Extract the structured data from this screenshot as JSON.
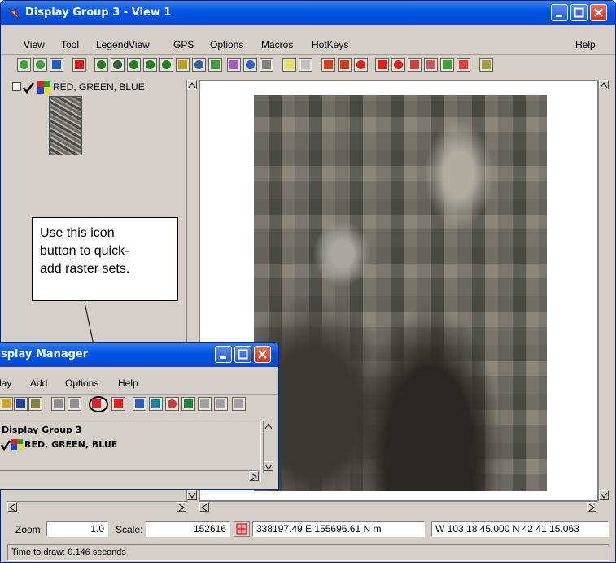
{
  "main_window": {
    "title": "Display Group 3 - View 1",
    "menu": [
      "View",
      "Tool",
      "LegendView",
      "GPS",
      "Options",
      "Macros",
      "HotKeys"
    ],
    "menu_right": "Help",
    "layer": {
      "label": "RED, GREEN, BLUE"
    },
    "status": {
      "zoom_label": "Zoom:",
      "zoom_value": "1.0",
      "scale_label": "Scale:",
      "scale_value": "152616",
      "coords_en": "338197.49 E  155696.61 N m",
      "coords_latlon": "W 103 18 45.000  N 42 41 15.063",
      "time_to_draw": "Time to draw: 0.146 seconds"
    }
  },
  "display_manager": {
    "title": "splay Manager",
    "menu": [
      "lay",
      "Add",
      "Options",
      "Help"
    ],
    "group_name": "Display Group 3",
    "layer_label": "RED, GREEN, BLUE"
  },
  "callout": {
    "lines": [
      "Use this icon",
      "button to quick-",
      "add raster sets."
    ]
  },
  "colors": {
    "title_blue": "#0054e3",
    "chrome": "#d4d0c8",
    "close_red": "#c03818"
  }
}
